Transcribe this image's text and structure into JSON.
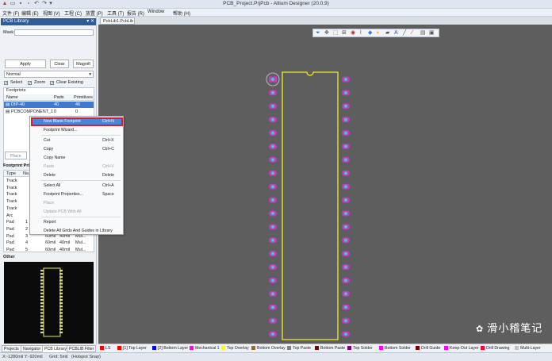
{
  "window": {
    "title": "PCB_Project.PrjPcb - Altium Designer (20.0.9)"
  },
  "menu": [
    "文件 (F)",
    "编辑 (E)",
    "视图 (V)",
    "工程 (C)",
    "放置 (P)",
    "工具 (T)",
    "报告 (R)",
    "Window",
    "帮助 (H)"
  ],
  "panel": {
    "title": "PCB Library",
    "mask_label": "Mask",
    "apply_label": "Apply",
    "clear_label": "Clear",
    "magnify_label": "Magnifi",
    "filter_value": "Normal",
    "select_label": "Select",
    "zoom_label": "Zoom",
    "clear_existing_label": "Clear Existing",
    "footprints_header": "Footprints",
    "columns": [
      "Name",
      "Pads",
      "Primitives"
    ],
    "rows": [
      {
        "name": "DIP-40",
        "pads": "40",
        "primitives": "46"
      },
      {
        "name": "PCBCOMPONENT_1",
        "pads": "0",
        "primitives": "0"
      }
    ],
    "place_label": "Place",
    "primitives_header": "Footprint Pri",
    "prim_columns": [
      "Type",
      "Na"
    ],
    "prim_rows": [
      {
        "type": "Track",
        "name": "",
        "x": "",
        "y": "",
        "layer": ""
      },
      {
        "type": "Track",
        "name": "",
        "x": "",
        "y": "",
        "layer": ""
      },
      {
        "type": "Track",
        "name": "",
        "x": "",
        "y": "",
        "layer": ""
      },
      {
        "type": "Track",
        "name": "",
        "x": "",
        "y": "",
        "layer": ""
      },
      {
        "type": "Track",
        "name": "",
        "x": "",
        "y": "",
        "layer": ""
      },
      {
        "type": "Arc",
        "name": "",
        "x": "",
        "y": "",
        "layer": ""
      },
      {
        "type": "Pad",
        "name": "1",
        "x": "",
        "y": "",
        "layer": ""
      },
      {
        "type": "Pad",
        "name": "2",
        "x": "",
        "y": "",
        "layer": ""
      },
      {
        "type": "Pad",
        "name": "3",
        "x": "60mil",
        "y": "40mil",
        "layer": "Mul..."
      },
      {
        "type": "Pad",
        "name": "4",
        "x": "60mil",
        "y": "40mil",
        "layer": "Mul..."
      },
      {
        "type": "Pad",
        "name": "5",
        "x": "60mil",
        "y": "40mil",
        "layer": "Mul..."
      }
    ],
    "other_header": "Other"
  },
  "context_menu": {
    "items": [
      {
        "label": "New Blank Footprint",
        "shortcut": "Ctrl+N",
        "disabled": false
      },
      {
        "label": "Footprint Wizard...",
        "shortcut": "",
        "disabled": false
      },
      {
        "label": "Cut",
        "shortcut": "Ctrl+X",
        "disabled": false
      },
      {
        "label": "Copy",
        "shortcut": "Ctrl+C",
        "disabled": false
      },
      {
        "label": "Copy Name",
        "shortcut": "",
        "disabled": false
      },
      {
        "label": "Paste",
        "shortcut": "Ctrl+V",
        "disabled": true
      },
      {
        "label": "Delete",
        "shortcut": "Delete",
        "disabled": false
      },
      {
        "label": "Select All",
        "shortcut": "Ctrl+A",
        "disabled": false
      },
      {
        "label": "Footprint Properties...",
        "shortcut": "Space",
        "disabled": false
      },
      {
        "label": "Place",
        "shortcut": "",
        "disabled": true
      },
      {
        "label": "Update PCB With All",
        "shortcut": "",
        "disabled": true
      },
      {
        "label": "Report",
        "shortcut": "",
        "disabled": false
      },
      {
        "label": "Delete All Grids And Guides in Library",
        "shortcut": "",
        "disabled": false
      }
    ]
  },
  "document_tab": "PcbLib1.PcbLib",
  "bottom_tabs": [
    "Projects",
    "Navigator",
    "PCB Library",
    "PCBLIB Filter"
  ],
  "layers": [
    {
      "name": "LS",
      "color": "#ff0000"
    },
    {
      "name": "[1] Top Layer",
      "color": "#ff0000"
    },
    {
      "name": "[2] Bottom Layer",
      "color": "#0000ff"
    },
    {
      "name": "Mechanical 1",
      "color": "#ff00ff"
    },
    {
      "name": "Top Overlay",
      "color": "#ffff00"
    },
    {
      "name": "Bottom Overlay",
      "color": "#996633"
    },
    {
      "name": "Top Paste",
      "color": "#808080"
    },
    {
      "name": "Bottom Paste",
      "color": "#800000"
    },
    {
      "name": "Top Solder",
      "color": "#800080"
    },
    {
      "name": "Bottom Solder",
      "color": "#ff00ff"
    },
    {
      "name": "Drill Guide",
      "color": "#800000"
    },
    {
      "name": "Keep-Out Layer",
      "color": "#ff00ff"
    },
    {
      "name": "Drill Drawing",
      "color": "#ff002a"
    },
    {
      "name": "Multi-Layer",
      "color": "#c0c0c0"
    }
  ],
  "status": {
    "coords": "X:-1280mil Y:-920mil",
    "grid": "Grid: 5mil",
    "snap": "(Hotspot Snap)"
  },
  "watermark": "滑小稽笔记",
  "footprint": {
    "pins_per_side": 20
  }
}
